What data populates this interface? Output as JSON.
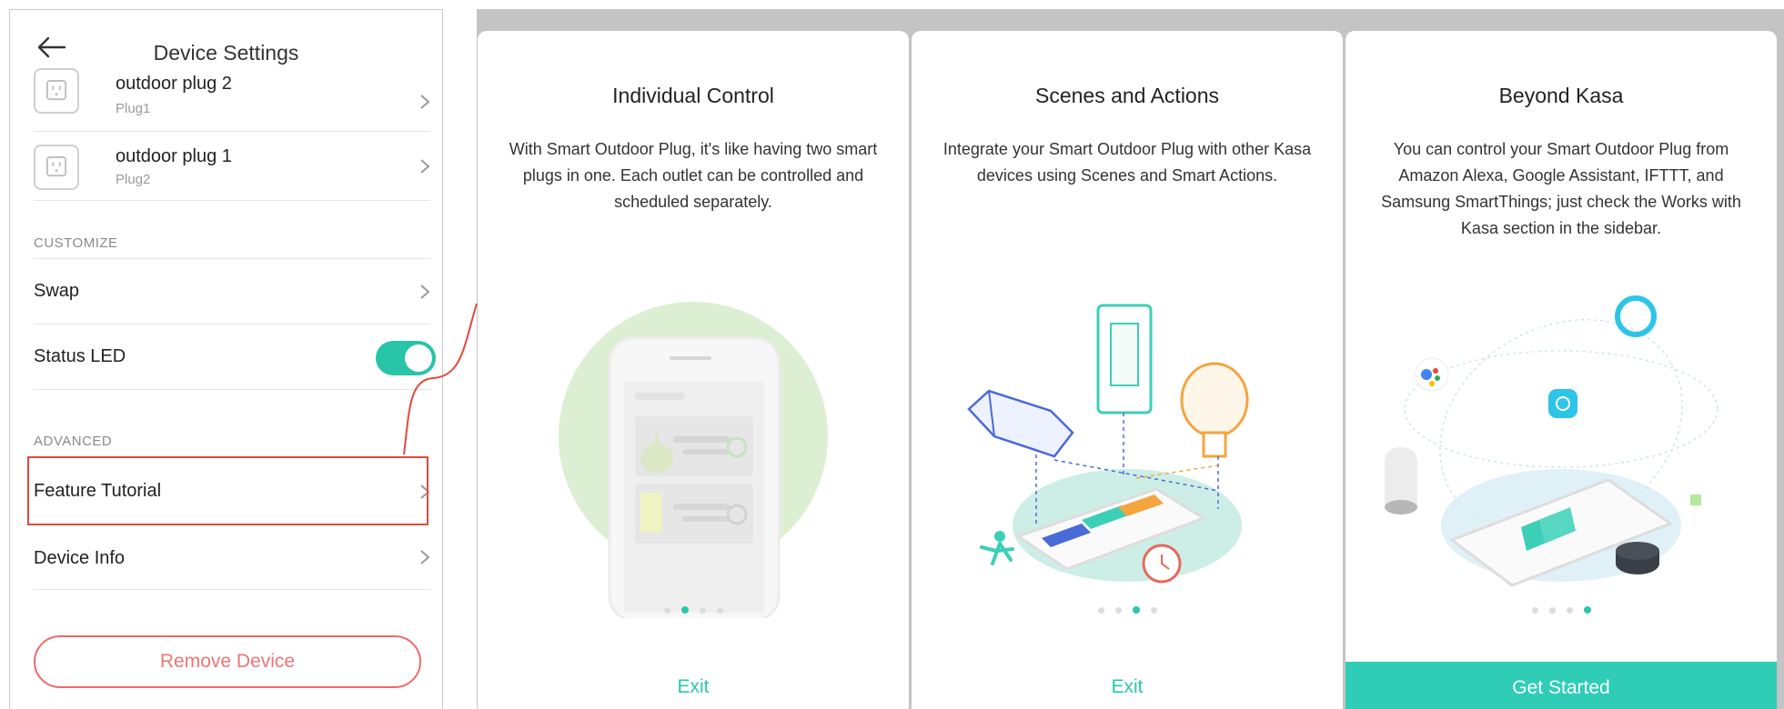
{
  "settings": {
    "title": "Device Settings",
    "plugs": [
      {
        "name": "outdoor plug 2",
        "sub": "Plug1"
      },
      {
        "name": "outdoor plug 1",
        "sub": "Plug2"
      }
    ],
    "customize_label": "CUSTOMIZE",
    "swap_label": "Swap",
    "status_led_label": "Status LED",
    "status_led_on": true,
    "advanced_label": "ADVANCED",
    "feature_tutorial_label": "Feature Tutorial",
    "device_info_label": "Device Info",
    "remove_label": "Remove Device"
  },
  "tutorial": {
    "cards": [
      {
        "title": "Individual Control",
        "body": "With Smart Outdoor Plug, it's like having two smart plugs in one. Each outlet can be controlled and scheduled separately.",
        "active_dot": 1,
        "action": "Exit"
      },
      {
        "title": "Scenes and Actions",
        "body": "Integrate your Smart Outdoor Plug with other Kasa devices using Scenes and Smart Actions.",
        "active_dot": 2,
        "action": "Exit"
      },
      {
        "title": "Beyond Kasa",
        "body": "You can control your Smart Outdoor Plug from Amazon Alexa, Google Assistant, IFTTT, and Samsung SmartThings; just check the Works with Kasa section in the sidebar.",
        "active_dot": 3,
        "action": "Get Started"
      }
    ]
  },
  "colors": {
    "accent": "#2bc6ae",
    "danger": "#ef6a6a",
    "highlight": "#e04a3c"
  }
}
